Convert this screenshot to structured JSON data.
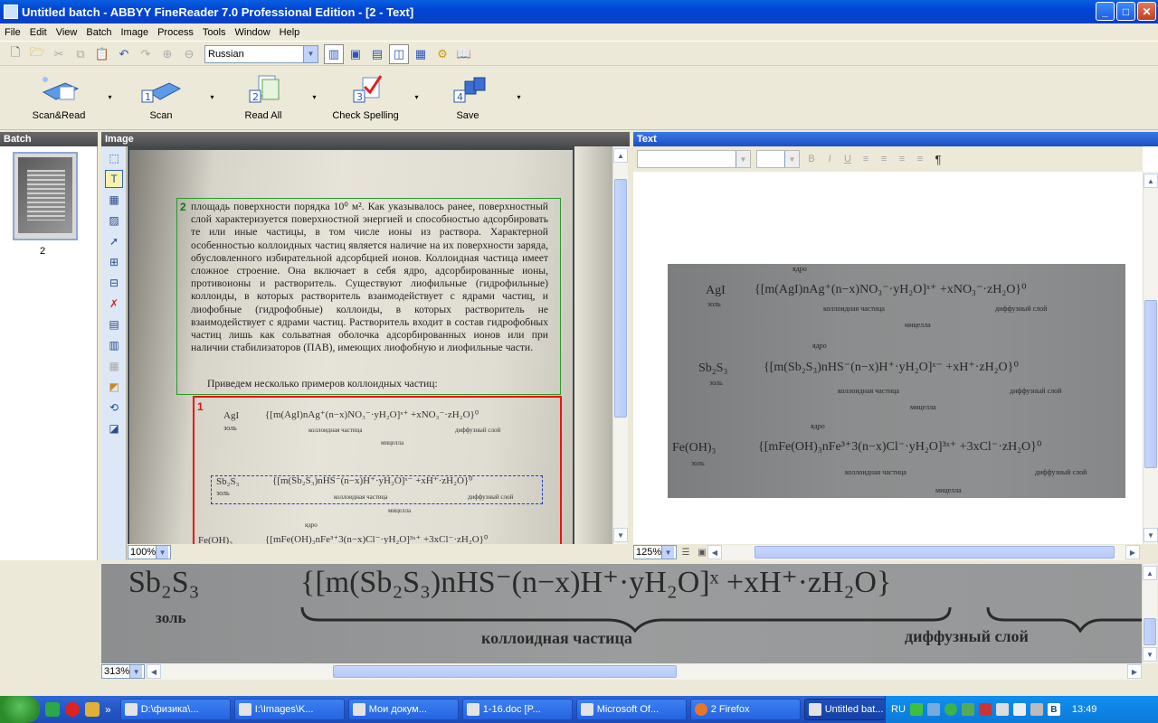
{
  "window": {
    "title": "Untitled batch - ABBYY FineReader 7.0 Professional Edition - [2 - Text]",
    "controls": {
      "minimize": "_",
      "maximize": "□",
      "close": "✕"
    }
  },
  "menu": [
    "File",
    "Edit",
    "View",
    "Batch",
    "Image",
    "Process",
    "Tools",
    "Window",
    "Help"
  ],
  "toolbar": {
    "language": "Russian",
    "buttons": [
      {
        "label": "Scan&Read",
        "num": ""
      },
      {
        "label": "Scan",
        "num": "1"
      },
      {
        "label": "Read All",
        "num": "2"
      },
      {
        "label": "Check Spelling",
        "num": "3"
      },
      {
        "label": "Save",
        "num": "4"
      }
    ],
    "dropdown": "▾"
  },
  "panels": {
    "batch": "Batch",
    "image": "Image",
    "text": "Text"
  },
  "batch": {
    "page_number": "2"
  },
  "image_page": {
    "block2_number": "2",
    "block1_number": "1",
    "paragraph": "площадь поверхности порядка 10⁰ м². Как указывалось ранее, поверхностный слой характеризуется поверхностной энергией и способностью адсорбировать те или иные частицы, в том числе ионы из раствора. Характерной особенностью коллоидных частиц является наличие на их поверхности заряда, обусловленного избирательной адсорбцией ионов. Коллоидная частица имеет сложное строение. Она включает в себя ядро, адсорбированные ионы, противоионы и растворитель. Существуют лиофильные (гидрофильные) коллоиды, в которых растворитель взаимодействует с ядрами частиц, и лиофобные (гидрофобные) коллоиды, в которых растворитель не взаимодействует с ядрами частиц. Растворитель входит в состав гидрофобных частиц лишь как сольватная оболочка адсорбированных ионов или при наличии стабилизаторов (ПАВ), имеющих лиофобную и лиофильные части.",
    "intro": "Приведем несколько примеров коллоидных частиц:",
    "f1_name": "AgI",
    "f1_formula": "{[m(AgI)nAg⁺(n−x)NO₃⁻·yH₂O]ˣ⁺ +xNO₃⁻·zH₂O}⁰",
    "f2_name": "Sb₂S₃",
    "f2_formula": "{[m(Sb₂S₃)nHS⁻(n−x)H⁺·yH₂O]ˣ⁻ +xH⁺·zH₂O}⁰",
    "f3_name": "Fe(OH)₃",
    "f3_formula": "{[mFe(OH)₃nFe³⁺3(n−x)Cl⁻·yH₂O]³ˣ⁺ +3xCl⁻·zH₂O}⁰",
    "sol": "золь",
    "nucleus": "ядро",
    "particle": "коллоидная частица",
    "diffuse": "диффузный слой",
    "micelle": "мицелла",
    "zoom": "100%"
  },
  "text_view": {
    "zoom": "125%",
    "pilcrow": "¶",
    "fmt_buttons": [
      "B",
      "I",
      "U",
      "≡",
      "≡",
      "≡",
      "≡"
    ]
  },
  "zoom_view": {
    "zoom": "313%",
    "name": "Sb₂S₃",
    "formula": "{[m(Sb₂S₃)nHS⁻(n−x)H⁺·yH₂O]ˣ +xH⁺·zH₂O}",
    "sol": "золь",
    "particle": "коллоидная частица",
    "diffuse": "диффузный слой"
  },
  "taskbar": {
    "quick_more": "»",
    "tasks": [
      {
        "label": "D:\\физика\\..."
      },
      {
        "label": "I:\\Images\\K..."
      },
      {
        "label": "Мои докум..."
      },
      {
        "label": "1-16.doc [P..."
      },
      {
        "label": "Microsoft Of..."
      },
      {
        "label": "2 Firefox"
      },
      {
        "label": "Untitled bat..."
      }
    ],
    "lang": "RU",
    "time": "13:49",
    "tray_b": "B"
  },
  "colors": {
    "accent": "#0a4fd6",
    "block_green": "#2a9a2a",
    "block_red": "#e11111",
    "selection": "#1f3ad3"
  }
}
